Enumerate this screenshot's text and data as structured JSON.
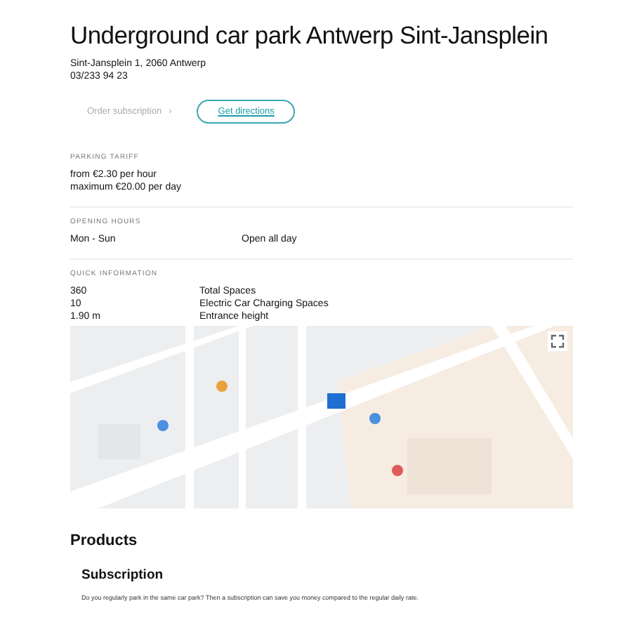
{
  "title": "Underground car park Antwerp Sint-Jansplein",
  "address": "Sint-Jansplein 1, 2060 Antwerp",
  "phone": "03/233 94 23",
  "actions": {
    "subscription": "Order subscription",
    "chevron": "›",
    "directions": "Get directions"
  },
  "tariff": {
    "heading": "PARKING TARIFF",
    "lines": [
      "from €2.30 per hour",
      "maximum €20.00 per day"
    ]
  },
  "hours": {
    "heading": "OPENING HOURS",
    "rows": [
      {
        "days": "Mon - Sun",
        "time": "Open all day"
      }
    ]
  },
  "quick_info": {
    "heading": "QUICK INFORMATION",
    "rows": [
      {
        "value": "360",
        "label": "Total Spaces"
      },
      {
        "value": "10",
        "label": "Electric Car Charging Spaces"
      },
      {
        "value": "1.90 m",
        "label": "Entrance height"
      }
    ]
  },
  "products": {
    "heading": "Products",
    "items": [
      {
        "title": "Subscription",
        "text": "Do you regularly park in the same car park? Then a subscription can save you money compared to the regular daily rate."
      }
    ]
  }
}
